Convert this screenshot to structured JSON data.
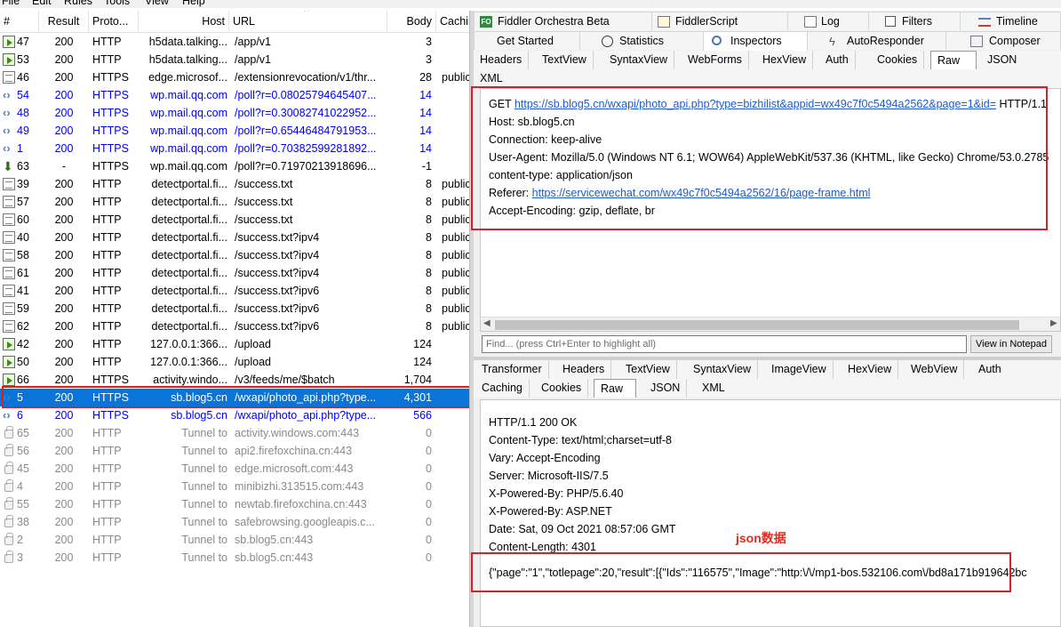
{
  "menu": [
    "File",
    "Edit",
    "Rules",
    "Tools",
    "View",
    "Help"
  ],
  "sessions": {
    "columns": [
      "#",
      "Result",
      "Proto...",
      "Host",
      "URL",
      "Body",
      "Caching"
    ],
    "rows": [
      {
        "num": "47",
        "result": "200",
        "proto": "HTTP",
        "host": "h5data.talking...",
        "url": "/app/v1",
        "body": "3",
        "cache": "",
        "icon": "arrow-icon",
        "style": "normal"
      },
      {
        "num": "53",
        "result": "200",
        "proto": "HTTP",
        "host": "h5data.talking...",
        "url": "/app/v1",
        "body": "3",
        "cache": "",
        "icon": "arrow-icon",
        "style": "normal"
      },
      {
        "num": "46",
        "result": "200",
        "proto": "HTTPS",
        "host": "edge.microsof...",
        "url": "/extensionrevocation/v1/thr...",
        "body": "28",
        "cache": "public",
        "icon": "document-icon",
        "style": "normal"
      },
      {
        "num": "54",
        "result": "200",
        "proto": "HTTPS",
        "host": "wp.mail.qq.com",
        "url": "/poll?r=0.08025794645407...",
        "body": "14",
        "cache": "",
        "icon": "bidirectional-icon",
        "style": "blue"
      },
      {
        "num": "48",
        "result": "200",
        "proto": "HTTPS",
        "host": "wp.mail.qq.com",
        "url": "/poll?r=0.30082741022952...",
        "body": "14",
        "cache": "",
        "icon": "bidirectional-icon",
        "style": "blue"
      },
      {
        "num": "49",
        "result": "200",
        "proto": "HTTPS",
        "host": "wp.mail.qq.com",
        "url": "/poll?r=0.65446484791953...",
        "body": "14",
        "cache": "",
        "icon": "bidirectional-icon",
        "style": "blue"
      },
      {
        "num": "1",
        "result": "200",
        "proto": "HTTPS",
        "host": "wp.mail.qq.com",
        "url": "/poll?r=0.70382599281892...",
        "body": "14",
        "cache": "",
        "icon": "bidirectional-icon",
        "style": "blue"
      },
      {
        "num": "63",
        "result": "-",
        "proto": "HTTPS",
        "host": "wp.mail.qq.com",
        "url": "/poll?r=0.71970213918696...",
        "body": "-1",
        "cache": "",
        "icon": "download-arrow-icon",
        "style": "normal"
      },
      {
        "num": "39",
        "result": "200",
        "proto": "HTTP",
        "host": "detectportal.fi...",
        "url": "/success.txt",
        "body": "8",
        "cache": "public",
        "icon": "document-icon",
        "style": "normal"
      },
      {
        "num": "57",
        "result": "200",
        "proto": "HTTP",
        "host": "detectportal.fi...",
        "url": "/success.txt",
        "body": "8",
        "cache": "public",
        "icon": "document-icon",
        "style": "normal"
      },
      {
        "num": "60",
        "result": "200",
        "proto": "HTTP",
        "host": "detectportal.fi...",
        "url": "/success.txt",
        "body": "8",
        "cache": "public",
        "icon": "document-icon",
        "style": "normal"
      },
      {
        "num": "40",
        "result": "200",
        "proto": "HTTP",
        "host": "detectportal.fi...",
        "url": "/success.txt?ipv4",
        "body": "8",
        "cache": "public",
        "icon": "document-icon",
        "style": "normal"
      },
      {
        "num": "58",
        "result": "200",
        "proto": "HTTP",
        "host": "detectportal.fi...",
        "url": "/success.txt?ipv4",
        "body": "8",
        "cache": "public",
        "icon": "document-icon",
        "style": "normal"
      },
      {
        "num": "61",
        "result": "200",
        "proto": "HTTP",
        "host": "detectportal.fi...",
        "url": "/success.txt?ipv4",
        "body": "8",
        "cache": "public",
        "icon": "document-icon",
        "style": "normal"
      },
      {
        "num": "41",
        "result": "200",
        "proto": "HTTP",
        "host": "detectportal.fi...",
        "url": "/success.txt?ipv6",
        "body": "8",
        "cache": "public",
        "icon": "document-icon",
        "style": "normal"
      },
      {
        "num": "59",
        "result": "200",
        "proto": "HTTP",
        "host": "detectportal.fi...",
        "url": "/success.txt?ipv6",
        "body": "8",
        "cache": "public",
        "icon": "document-icon",
        "style": "normal"
      },
      {
        "num": "62",
        "result": "200",
        "proto": "HTTP",
        "host": "detectportal.fi...",
        "url": "/success.txt?ipv6",
        "body": "8",
        "cache": "public",
        "icon": "document-icon",
        "style": "normal"
      },
      {
        "num": "42",
        "result": "200",
        "proto": "HTTP",
        "host": "127.0.0.1:366...",
        "url": "/upload",
        "body": "124",
        "cache": "",
        "icon": "arrow-icon",
        "style": "normal"
      },
      {
        "num": "50",
        "result": "200",
        "proto": "HTTP",
        "host": "127.0.0.1:366...",
        "url": "/upload",
        "body": "124",
        "cache": "",
        "icon": "arrow-icon",
        "style": "normal"
      },
      {
        "num": "66",
        "result": "200",
        "proto": "HTTPS",
        "host": "activity.windo...",
        "url": "/v3/feeds/me/$batch",
        "body": "1,704",
        "cache": "",
        "icon": "arrow-icon",
        "style": "normal"
      },
      {
        "num": "5",
        "result": "200",
        "proto": "HTTPS",
        "host": "sb.blog5.cn",
        "url": "/wxapi/photo_api.php?type...",
        "body": "4,301",
        "cache": "",
        "icon": "bidirectional-icon",
        "style": "selected"
      },
      {
        "num": "6",
        "result": "200",
        "proto": "HTTPS",
        "host": "sb.blog5.cn",
        "url": "/wxapi/photo_api.php?type...",
        "body": "566",
        "cache": "",
        "icon": "bidirectional-icon",
        "style": "blue"
      },
      {
        "num": "65",
        "result": "200",
        "proto": "HTTP",
        "host": "Tunnel to",
        "url": "activity.windows.com:443",
        "body": "0",
        "cache": "",
        "icon": "lock-icon",
        "style": "gray"
      },
      {
        "num": "56",
        "result": "200",
        "proto": "HTTP",
        "host": "Tunnel to",
        "url": "api2.firefoxchina.cn:443",
        "body": "0",
        "cache": "",
        "icon": "lock-icon",
        "style": "gray"
      },
      {
        "num": "45",
        "result": "200",
        "proto": "HTTP",
        "host": "Tunnel to",
        "url": "edge.microsoft.com:443",
        "body": "0",
        "cache": "",
        "icon": "lock-icon",
        "style": "gray"
      },
      {
        "num": "4",
        "result": "200",
        "proto": "HTTP",
        "host": "Tunnel to",
        "url": "minibizhi.313515.com:443",
        "body": "0",
        "cache": "",
        "icon": "lock-icon",
        "style": "gray"
      },
      {
        "num": "55",
        "result": "200",
        "proto": "HTTP",
        "host": "Tunnel to",
        "url": "newtab.firefoxchina.cn:443",
        "body": "0",
        "cache": "",
        "icon": "lock-icon",
        "style": "gray"
      },
      {
        "num": "38",
        "result": "200",
        "proto": "HTTP",
        "host": "Tunnel to",
        "url": "safebrowsing.googleapis.c...",
        "body": "0",
        "cache": "",
        "icon": "lock-icon",
        "style": "gray"
      },
      {
        "num": "2",
        "result": "200",
        "proto": "HTTP",
        "host": "Tunnel to",
        "url": "sb.blog5.cn:443",
        "body": "0",
        "cache": "",
        "icon": "lock-icon",
        "style": "gray"
      },
      {
        "num": "3",
        "result": "200",
        "proto": "HTTP",
        "host": "Tunnel to",
        "url": "sb.blog5.cn:443",
        "body": "0",
        "cache": "",
        "icon": "lock-icon",
        "style": "gray"
      }
    ]
  },
  "main_tabs": {
    "row1": [
      {
        "label": "Fiddler Orchestra Beta",
        "icon": "fo-icon"
      },
      {
        "label": "FiddlerScript",
        "icon": "script-icon"
      },
      {
        "label": "Log",
        "icon": "log-icon"
      },
      {
        "label": "Filters",
        "icon": "checkbox-icon"
      },
      {
        "label": "Timeline",
        "icon": "timeline-icon"
      }
    ],
    "row2": [
      {
        "label": "Get Started",
        "icon": ""
      },
      {
        "label": "Statistics",
        "icon": "stopwatch-icon"
      },
      {
        "label": "Inspectors",
        "icon": "magnifier-icon",
        "active": true
      },
      {
        "label": "AutoResponder",
        "icon": "lightning-icon"
      },
      {
        "label": "Composer",
        "icon": "composer-icon"
      }
    ]
  },
  "request": {
    "tabs": [
      "Headers",
      "TextView",
      "SyntaxView",
      "WebForms",
      "HexView",
      "Auth",
      "Cookies",
      "Raw",
      "JSON",
      "XML"
    ],
    "active_tab": "Raw",
    "lines": [
      {
        "prefix": "GET ",
        "link": "https://sb.blog5.cn/wxapi/photo_api.php?type=bizhilist&appid=wx49c7f0c5494a2562&page=1&id=",
        "suffix": " HTTP/1.1"
      },
      {
        "prefix": "Host: sb.blog5.cn",
        "link": "",
        "suffix": ""
      },
      {
        "prefix": "Connection: keep-alive",
        "link": "",
        "suffix": ""
      },
      {
        "prefix": "User-Agent: Mozilla/5.0 (Windows NT 6.1; WOW64) AppleWebKit/537.36 (KHTML, like Gecko) Chrome/53.0.2785",
        "link": "",
        "suffix": ""
      },
      {
        "prefix": "content-type: application/json",
        "link": "",
        "suffix": ""
      },
      {
        "prefix": "Referer: ",
        "link": "https://servicewechat.com/wx49c7f0c5494a2562/16/page-frame.html",
        "suffix": ""
      },
      {
        "prefix": "Accept-Encoding: gzip, deflate, br",
        "link": "",
        "suffix": ""
      }
    ],
    "find_placeholder": "Find... (press Ctrl+Enter to highlight all)",
    "notepad_button": "View in Notepad"
  },
  "response": {
    "tabs_row1": [
      "Transformer",
      "Headers",
      "TextView",
      "SyntaxView",
      "ImageView",
      "HexView",
      "WebView",
      "Auth"
    ],
    "tabs_row2": [
      "Caching",
      "Cookies",
      "Raw",
      "JSON",
      "XML"
    ],
    "active_tab": "Raw",
    "lines": [
      "HTTP/1.1 200 OK",
      "Content-Type: text/html;charset=utf-8",
      "Vary: Accept-Encoding",
      "Server: Microsoft-IIS/7.5",
      "X-Powered-By: PHP/5.6.40",
      "X-Powered-By: ASP.NET",
      "Date: Sat, 09 Oct 2021 08:57:06 GMT",
      "Content-Length: 4301"
    ],
    "annotation": "json数据",
    "json_line": "{\"page\":\"1\",\"totlepage\":20,\"result\":[{\"Ids\":\"116575\",\"Image\":\"http:\\/\\/mp1-bos.532106.com\\/bd8a171b919642bc"
  },
  "colors": {
    "selection": "#0a74d8",
    "highlight_box": "#d2222a",
    "link": "#1e5bc6"
  }
}
